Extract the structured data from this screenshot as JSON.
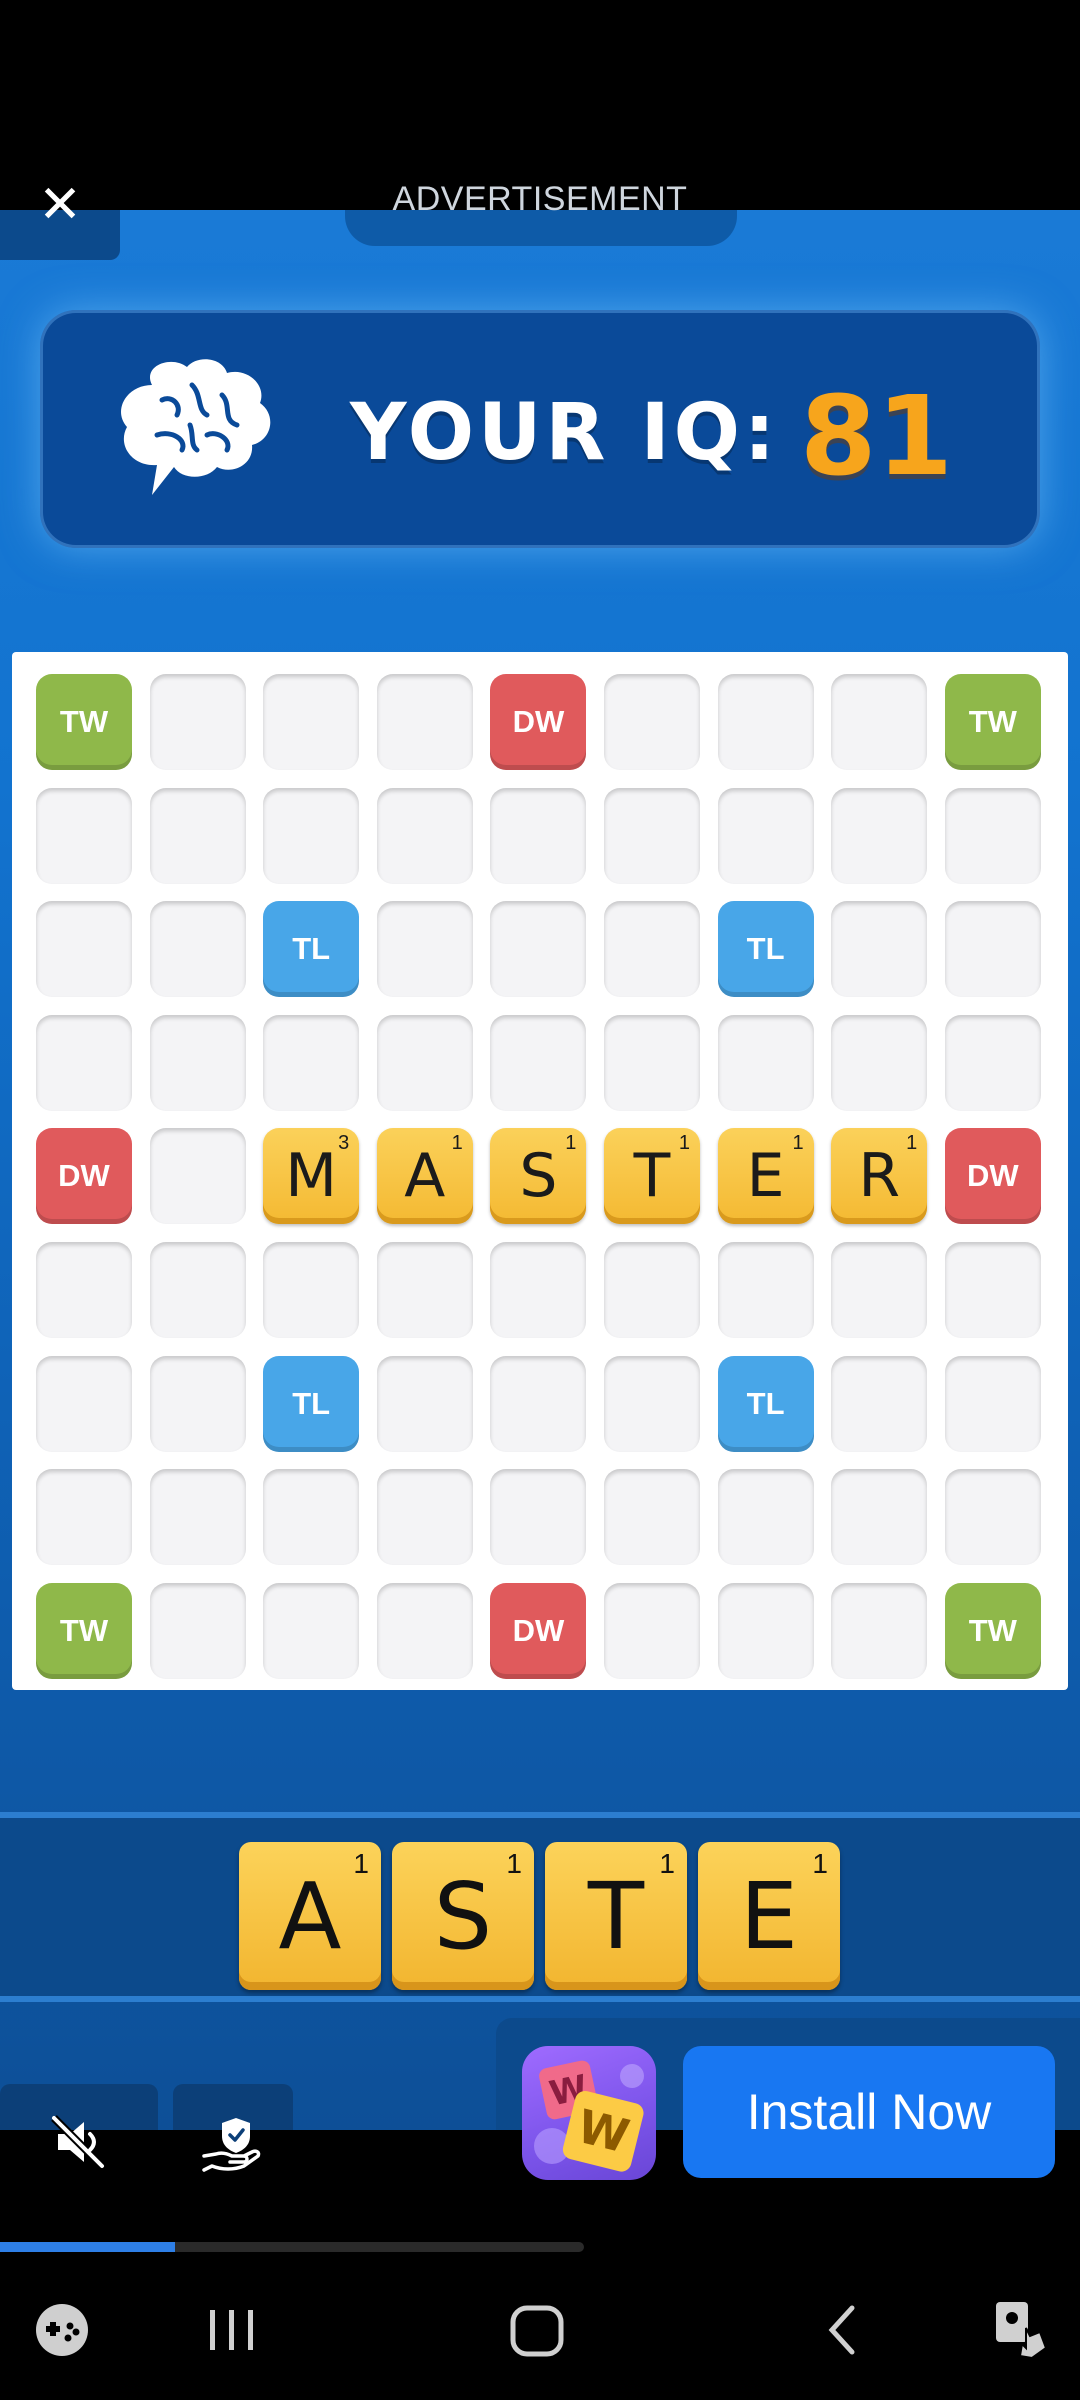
{
  "ad": {
    "label": "ADVERTISEMENT",
    "close_glyph": "✕"
  },
  "iq": {
    "label": "YOUR IQ:",
    "value": "81",
    "value_color": "#f7a51c"
  },
  "board": {
    "premiums": [
      {
        "row": 0,
        "col": 0,
        "type": "TW"
      },
      {
        "row": 0,
        "col": 4,
        "type": "DW"
      },
      {
        "row": 0,
        "col": 8,
        "type": "TW"
      },
      {
        "row": 2,
        "col": 2,
        "type": "TL"
      },
      {
        "row": 2,
        "col": 6,
        "type": "TL"
      },
      {
        "row": 4,
        "col": 0,
        "type": "DW"
      },
      {
        "row": 4,
        "col": 8,
        "type": "DW"
      },
      {
        "row": 6,
        "col": 2,
        "type": "TL"
      },
      {
        "row": 6,
        "col": 6,
        "type": "TL"
      },
      {
        "row": 8,
        "col": 0,
        "type": "TW"
      },
      {
        "row": 8,
        "col": 4,
        "type": "DW"
      },
      {
        "row": 8,
        "col": 8,
        "type": "TW"
      }
    ],
    "placed_word": [
      {
        "row": 4,
        "col": 2,
        "letter": "M",
        "points": "3"
      },
      {
        "row": 4,
        "col": 3,
        "letter": "A",
        "points": "1"
      },
      {
        "row": 4,
        "col": 4,
        "letter": "S",
        "points": "1"
      },
      {
        "row": 4,
        "col": 5,
        "letter": "T",
        "points": "1"
      },
      {
        "row": 4,
        "col": 6,
        "letter": "E",
        "points": "1"
      },
      {
        "row": 4,
        "col": 7,
        "letter": "R",
        "points": "1"
      }
    ],
    "colors": {
      "TW": "#8fb84a",
      "DW": "#e05a5c",
      "TL": "#48a6e8"
    }
  },
  "rack": [
    {
      "letter": "A",
      "points": "1"
    },
    {
      "letter": "S",
      "points": "1"
    },
    {
      "letter": "T",
      "points": "1"
    },
    {
      "letter": "E",
      "points": "1"
    }
  ],
  "cta": {
    "install_label": "Install Now",
    "app_icon_name": "words-app-icon"
  },
  "controls": {
    "mute_icon": "mute-icon",
    "privacy_icon": "shield-hand-icon"
  },
  "progress": {
    "fraction": 0.3
  },
  "navbar": {
    "icons": [
      "game-launcher-icon",
      "recent-apps-icon",
      "home-icon",
      "back-icon",
      "accessibility-icon"
    ]
  }
}
